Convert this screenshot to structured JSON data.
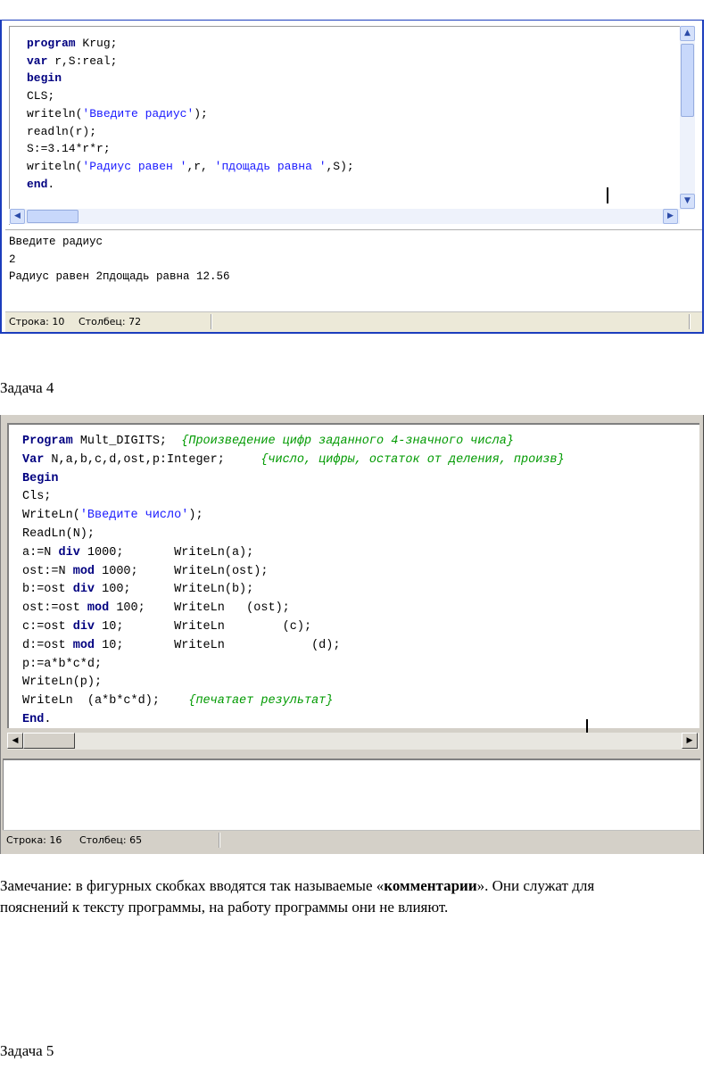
{
  "window1": {
    "code_lines": [
      [
        {
          "t": "program",
          "k": "kw"
        },
        {
          "t": " Krug;",
          "k": ""
        }
      ],
      [
        {
          "t": "var",
          "k": "kw"
        },
        {
          "t": " r,S:real;",
          "k": ""
        }
      ],
      [
        {
          "t": "begin",
          "k": "kw"
        }
      ],
      [
        {
          "t": "CLS;",
          "k": ""
        }
      ],
      [
        {
          "t": "writeln(",
          "k": ""
        },
        {
          "t": "'Введите радиус'",
          "k": "str"
        },
        {
          "t": ");",
          "k": ""
        }
      ],
      [
        {
          "t": "readln(r);",
          "k": ""
        }
      ],
      [
        {
          "t": "S:=3.14*r*r;",
          "k": ""
        }
      ],
      [
        {
          "t": "writeln(",
          "k": ""
        },
        {
          "t": "'Радиус равен '",
          "k": "str"
        },
        {
          "t": ",r, ",
          "k": ""
        },
        {
          "t": "'пдощадь равна '",
          "k": "str"
        },
        {
          "t": ",S);",
          "k": ""
        }
      ],
      [
        {
          "t": "end",
          "k": "kw"
        },
        {
          "t": ".",
          "k": ""
        }
      ]
    ],
    "output_lines": [
      "Введите радиус",
      "2",
      "Радиус равен 2пдощадь равна 12.56"
    ],
    "status_row": "Строка: 10",
    "status_col": "Столбец: 72"
  },
  "task4_heading": "Задача 4",
  "window2": {
    "code_lines": [
      [
        {
          "t": "Program",
          "k": "kw"
        },
        {
          "t": " Mult_DIGITS;  ",
          "k": ""
        },
        {
          "t": "{Произведение цифр заданного 4-значного числа}",
          "k": "cmt"
        }
      ],
      [
        {
          "t": "Var",
          "k": "kw"
        },
        {
          "t": " N,a,b,c,d,ost,p:Integer;     ",
          "k": ""
        },
        {
          "t": "{число, цифры, остаток от деления, произв}",
          "k": "cmt"
        }
      ],
      [
        {
          "t": "Begin",
          "k": "kw"
        }
      ],
      [
        {
          "t": "Cls;",
          "k": ""
        }
      ],
      [
        {
          "t": "WriteLn(",
          "k": ""
        },
        {
          "t": "'Введите число'",
          "k": "str"
        },
        {
          "t": ");",
          "k": ""
        }
      ],
      [
        {
          "t": "ReadLn(N);",
          "k": ""
        }
      ],
      [
        {
          "t": "a:=N ",
          "k": ""
        },
        {
          "t": "div",
          "k": "kw"
        },
        {
          "t": " 1000;       WriteLn(a);",
          "k": ""
        }
      ],
      [
        {
          "t": "ost:=N ",
          "k": ""
        },
        {
          "t": "mod",
          "k": "kw"
        },
        {
          "t": " 1000;     WriteLn(ost);",
          "k": ""
        }
      ],
      [
        {
          "t": "b:=ost ",
          "k": ""
        },
        {
          "t": "div",
          "k": "kw"
        },
        {
          "t": " 100;      WriteLn(b);",
          "k": ""
        }
      ],
      [
        {
          "t": "ost:=ost ",
          "k": ""
        },
        {
          "t": "mod",
          "k": "kw"
        },
        {
          "t": " 100;    WriteLn   (ost);",
          "k": ""
        }
      ],
      [
        {
          "t": "c:=ost ",
          "k": ""
        },
        {
          "t": "div",
          "k": "kw"
        },
        {
          "t": " 10;       WriteLn        (c);",
          "k": ""
        }
      ],
      [
        {
          "t": "d:=ost ",
          "k": ""
        },
        {
          "t": "mod",
          "k": "kw"
        },
        {
          "t": " 10;       WriteLn            (d);",
          "k": ""
        }
      ],
      [
        {
          "t": "p:=a*b*c*d;",
          "k": ""
        }
      ],
      [
        {
          "t": "WriteLn(p);",
          "k": ""
        }
      ],
      [
        {
          "t": "WriteLn  (a*b*c*d);    ",
          "k": ""
        },
        {
          "t": "{печатает результат}",
          "k": "cmt"
        }
      ],
      [
        {
          "t": "End",
          "k": "kw"
        },
        {
          "t": ".",
          "k": ""
        }
      ]
    ],
    "status_row": "Строка: 16",
    "status_col": "Столбец: 65"
  },
  "note": {
    "prefix": "Замечание: в фигурных скобках вводятся так называемые «",
    "bold": "комментарии",
    "suffix": "». Они служат для",
    "line2": "пояснений к тексту программы, на работу программы они не влияют."
  },
  "task5_heading": "Задача 5"
}
